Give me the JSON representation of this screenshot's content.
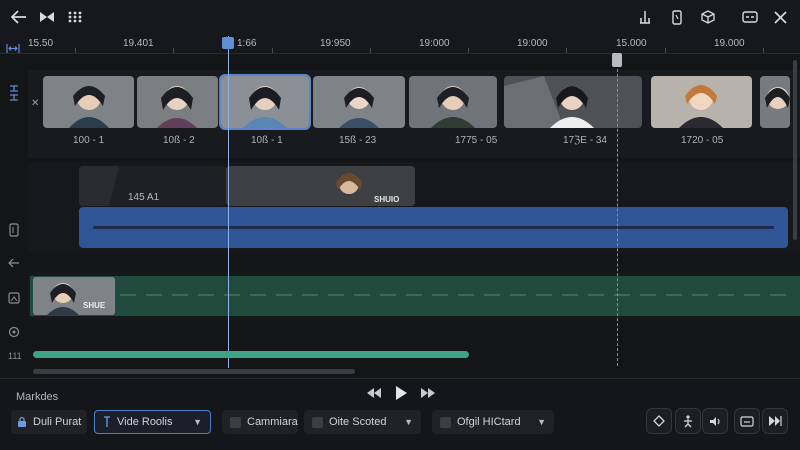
{
  "ruler": {
    "labels": [
      "15.50",
      "19.401",
      "1:66",
      "19:950",
      "19:000",
      "19:000",
      "15.000",
      "19.000"
    ]
  },
  "clips": [
    {
      "label": "100 - 1"
    },
    {
      "label": "10ß - 2"
    },
    {
      "label": "10ß - 1"
    },
    {
      "label": "15ß - 23"
    },
    {
      "label": "1775 - 05"
    },
    {
      "label": "17ℨE - 34"
    },
    {
      "label": "1720 - 05"
    }
  ],
  "overlay_track": {
    "label": "145 A1",
    "thumb_text": "SHUIO"
  },
  "green_track": {
    "thumb_text": "SHUE"
  },
  "left_panel": {
    "counter": "111"
  },
  "colors": {
    "accent": "#4f7ed0",
    "audio_bar": "#2f5597",
    "green_track": "#1f4a3c",
    "progress": "#3ea386",
    "playhead": "#8fb2e6"
  },
  "bottom": {
    "markers_label": "Markdes",
    "controls": {
      "dual_portal": "Duli Purat",
      "video_room": "Vide Roolis",
      "camera": "Cammiara",
      "scoring": "Oite Scoted",
      "hitcard": "Ofgil HICtard"
    }
  },
  "icons": {
    "top_left": [
      "back-arrow-icon",
      "bowtie-icon",
      "grid-dots-icon"
    ],
    "top_right": [
      "split-icon",
      "phone-icon",
      "cube-icon",
      "caption-icon",
      "close-icon"
    ],
    "right_tools": [
      "diamond-icon",
      "figure-icon",
      "volume-icon",
      "subtitle-icon",
      "skip-icon"
    ]
  }
}
